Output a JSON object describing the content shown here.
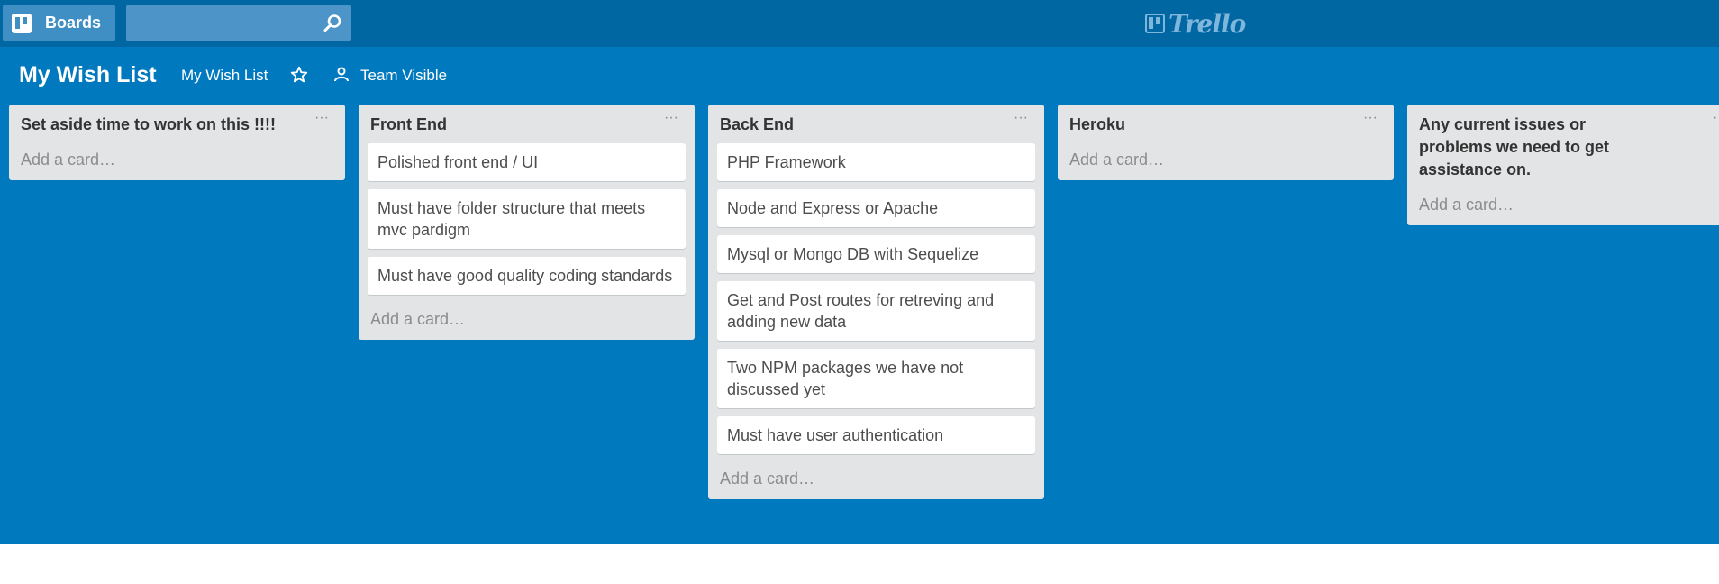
{
  "topbar": {
    "boards_label": "Boards",
    "search_placeholder": "",
    "logo_text": "Trello"
  },
  "board": {
    "title": "My Wish List",
    "org_label": "My Wish List",
    "visibility_label": "Team Visible"
  },
  "lists": [
    {
      "title": "Set aside time to work on this !!!!",
      "menu": "···",
      "cards": [],
      "add_card": "Add a card…"
    },
    {
      "title": "Front End",
      "menu": "···",
      "cards": [
        "Polished front end / UI",
        "Must have folder structure that meets mvc pardigm",
        "Must have good quality coding standards"
      ],
      "add_card": "Add a card…"
    },
    {
      "title": "Back End",
      "menu": "···",
      "cards": [
        "PHP Framework",
        "Node and Express or Apache",
        "Mysql or Mongo DB with Sequelize",
        "Get and Post routes for retreving and adding new data",
        "Two NPM packages we have not discussed yet",
        "Must have user authentication"
      ],
      "add_card": "Add a card…"
    },
    {
      "title": "Heroku",
      "menu": "···",
      "cards": [],
      "add_card": "Add a card…"
    },
    {
      "title": "Any current issues or problems we need to get assistance on.",
      "menu": "···",
      "cards": [],
      "add_card": "Add a card…"
    }
  ],
  "colors": {
    "board_bg": "#0079bf",
    "topbar_bg": "#0067a3",
    "list_bg": "#e2e4e6",
    "card_bg": "#ffffff"
  }
}
